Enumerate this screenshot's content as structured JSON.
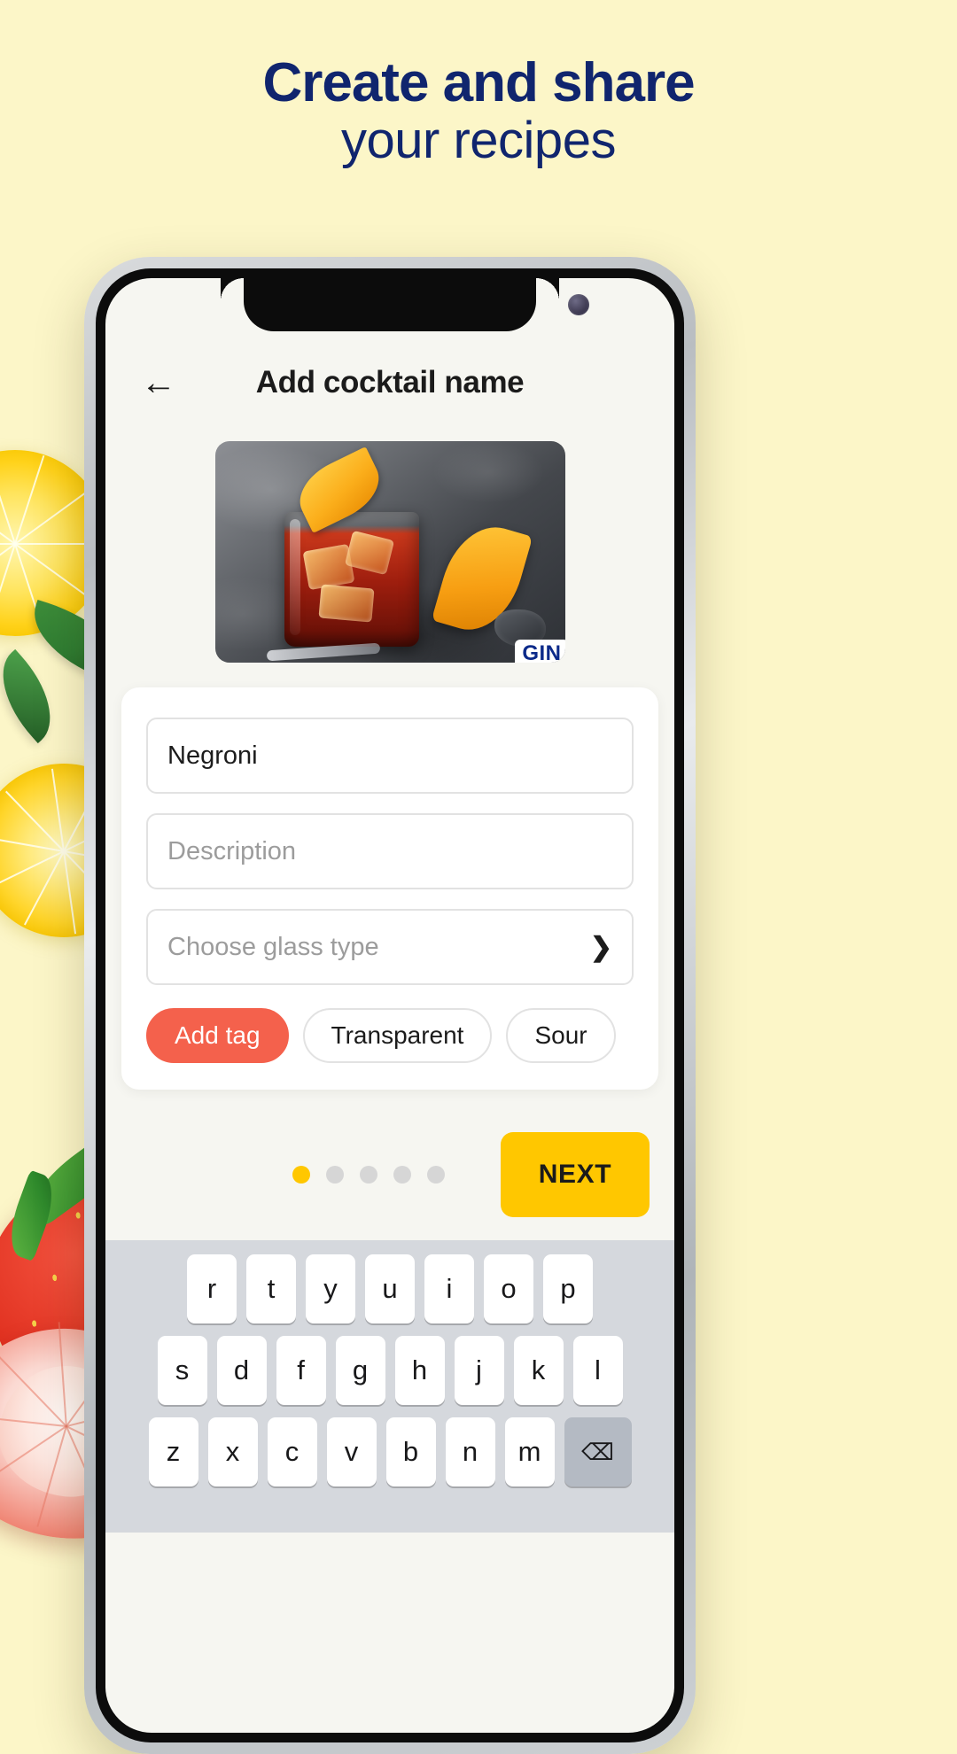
{
  "promo": {
    "headline_line1": "Create and share",
    "headline_line2": "your recipes",
    "bg_color": "#FCF6C8",
    "headline_color": "#10256E"
  },
  "app": {
    "title": "Add cocktail name",
    "back_icon": "←",
    "hero_badge": "GIN",
    "form": {
      "name_value": "Negroni",
      "description_placeholder": "Description",
      "glass_placeholder": "Choose glass type",
      "glass_chevron": "❯",
      "tags": [
        {
          "label": "Add tag",
          "primary": true
        },
        {
          "label": "Transparent",
          "primary": false
        },
        {
          "label": "Sour",
          "primary": false
        }
      ]
    },
    "footer": {
      "next_label": "NEXT",
      "next_color": "#FFC700",
      "dots_total": 5,
      "dots_active_index": 0
    },
    "keyboard": {
      "row1": [
        "r",
        "t",
        "y",
        "u",
        "i",
        "o",
        "p"
      ],
      "row2": [
        "s",
        "d",
        "f",
        "g",
        "h",
        "j",
        "k",
        "l"
      ],
      "row3": [
        "z",
        "x",
        "c",
        "v",
        "b",
        "n",
        "m"
      ],
      "backspace_icon": "⌫"
    }
  }
}
